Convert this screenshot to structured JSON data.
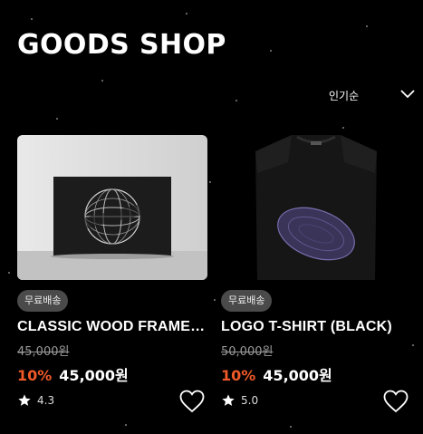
{
  "header": {
    "title": "GOODS SHOP"
  },
  "sort": {
    "label": "인기순",
    "icon": "chevron-down-icon"
  },
  "products": [
    {
      "badge": "무료배송",
      "name": "CLASSIC WOOD FRAME (L...",
      "original_price": "45,000원",
      "discount": "10%",
      "price": "45,000원",
      "rating": "4.3",
      "image_desc_icon": "frame-image",
      "like_icon": "heart-icon"
    },
    {
      "badge": "무료배송",
      "name": "LOGO T-SHIRT (BLACK)",
      "original_price": "50,000원",
      "discount": "10%",
      "price": "45,000원",
      "rating": "5.0",
      "image_desc_icon": "tshirt-image",
      "like_icon": "heart-icon"
    }
  ],
  "colors": {
    "background": "#000000",
    "accent_discount": "#f05a28",
    "badge_bg": "#4a4a4a"
  }
}
